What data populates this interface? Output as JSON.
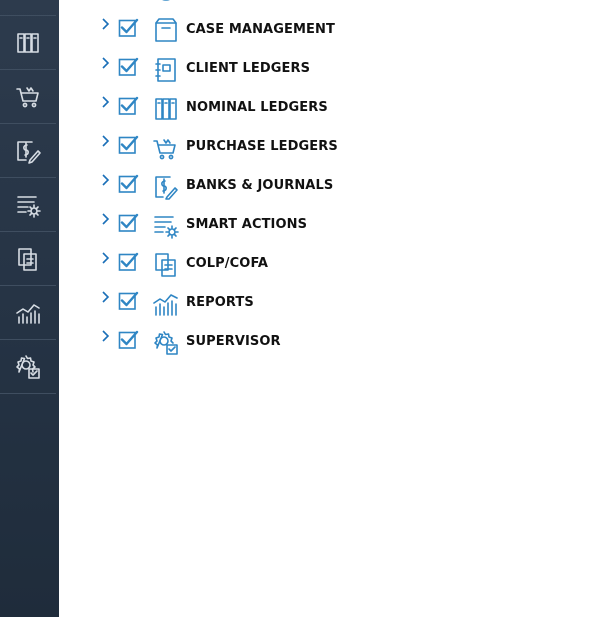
{
  "nav_rail": {
    "items": [
      {
        "icon": "layout-icon"
      },
      {
        "icon": "nominal-ledgers-icon"
      },
      {
        "icon": "shopping-cart-icon"
      },
      {
        "icon": "banks-journals-icon"
      },
      {
        "icon": "smart-actions-icon"
      },
      {
        "icon": "colp-cofa-icon"
      },
      {
        "icon": "reports-chart-icon"
      },
      {
        "icon": "supervisor-icon"
      }
    ]
  },
  "tree": {
    "items": [
      {
        "label": "CASE MANAGEMENT",
        "checked": true,
        "icon": "case-management-icon"
      },
      {
        "label": "CLIENT LEDGERS",
        "checked": true,
        "icon": "client-ledgers-icon"
      },
      {
        "label": "NOMINAL LEDGERS",
        "checked": true,
        "icon": "nominal-ledgers-icon"
      },
      {
        "label": "PURCHASE LEDGERS",
        "checked": true,
        "icon": "shopping-cart-icon"
      },
      {
        "label": "BANKS & JOURNALS",
        "checked": true,
        "icon": "banks-journals-icon"
      },
      {
        "label": "SMART ACTIONS",
        "checked": true,
        "icon": "smart-actions-icon"
      },
      {
        "label": "COLP/COFA",
        "checked": true,
        "icon": "colp-cofa-icon"
      },
      {
        "label": "REPORTS",
        "checked": true,
        "icon": "reports-chart-icon"
      },
      {
        "label": "SUPERVISOR",
        "checked": true,
        "icon": "supervisor-icon"
      }
    ]
  },
  "colors": {
    "rail_bg": "#26344a",
    "accent": "#2f86c4",
    "label_text": "#111111"
  }
}
